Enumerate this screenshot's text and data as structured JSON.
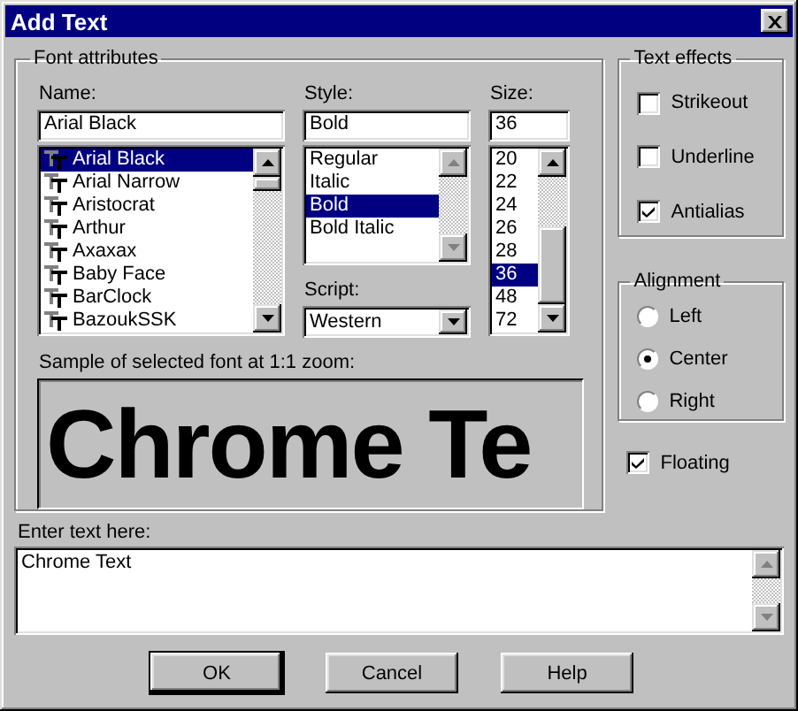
{
  "window": {
    "title": "Add Text"
  },
  "font_attributes": {
    "title": "Font attributes",
    "name": {
      "label": "Name:",
      "value": "Arial Black",
      "items": [
        {
          "label": "Arial Black",
          "selected": true
        },
        {
          "label": "Arial Narrow",
          "selected": false
        },
        {
          "label": "Aristocrat",
          "selected": false
        },
        {
          "label": "Arthur",
          "selected": false
        },
        {
          "label": "Axaxax",
          "selected": false
        },
        {
          "label": "Baby Face",
          "selected": false
        },
        {
          "label": "BarClock",
          "selected": false
        },
        {
          "label": "BazoukSSK",
          "selected": false
        }
      ]
    },
    "style": {
      "label": "Style:",
      "value": "Bold",
      "items": [
        {
          "label": "Regular",
          "selected": false
        },
        {
          "label": "Italic",
          "selected": false
        },
        {
          "label": "Bold",
          "selected": true
        },
        {
          "label": "Bold Italic",
          "selected": false
        }
      ]
    },
    "size": {
      "label": "Size:",
      "value": "36",
      "items": [
        {
          "label": "20",
          "selected": false
        },
        {
          "label": "22",
          "selected": false
        },
        {
          "label": "24",
          "selected": false
        },
        {
          "label": "26",
          "selected": false
        },
        {
          "label": "28",
          "selected": false
        },
        {
          "label": "36",
          "selected": true
        },
        {
          "label": "48",
          "selected": false
        },
        {
          "label": "72",
          "selected": false
        }
      ]
    },
    "script": {
      "label": "Script:",
      "value": "Western"
    },
    "sample": {
      "label": "Sample of selected font at 1:1 zoom:",
      "text": "Chrome Te"
    }
  },
  "text_effects": {
    "title": "Text effects",
    "items": [
      {
        "label": "Strikeout",
        "checked": false
      },
      {
        "label": "Underline",
        "checked": false
      },
      {
        "label": "Antialias",
        "checked": true
      }
    ]
  },
  "alignment": {
    "title": "Alignment",
    "options": [
      {
        "label": "Left",
        "selected": false
      },
      {
        "label": "Center",
        "selected": true
      },
      {
        "label": "Right",
        "selected": false
      }
    ]
  },
  "floating": {
    "label": "Floating",
    "checked": true
  },
  "entry": {
    "label": "Enter text here:",
    "value": "Chrome Text"
  },
  "buttons": [
    {
      "label": "OK",
      "default": true
    },
    {
      "label": "Cancel",
      "default": false
    },
    {
      "label": "Help",
      "default": false
    }
  ]
}
